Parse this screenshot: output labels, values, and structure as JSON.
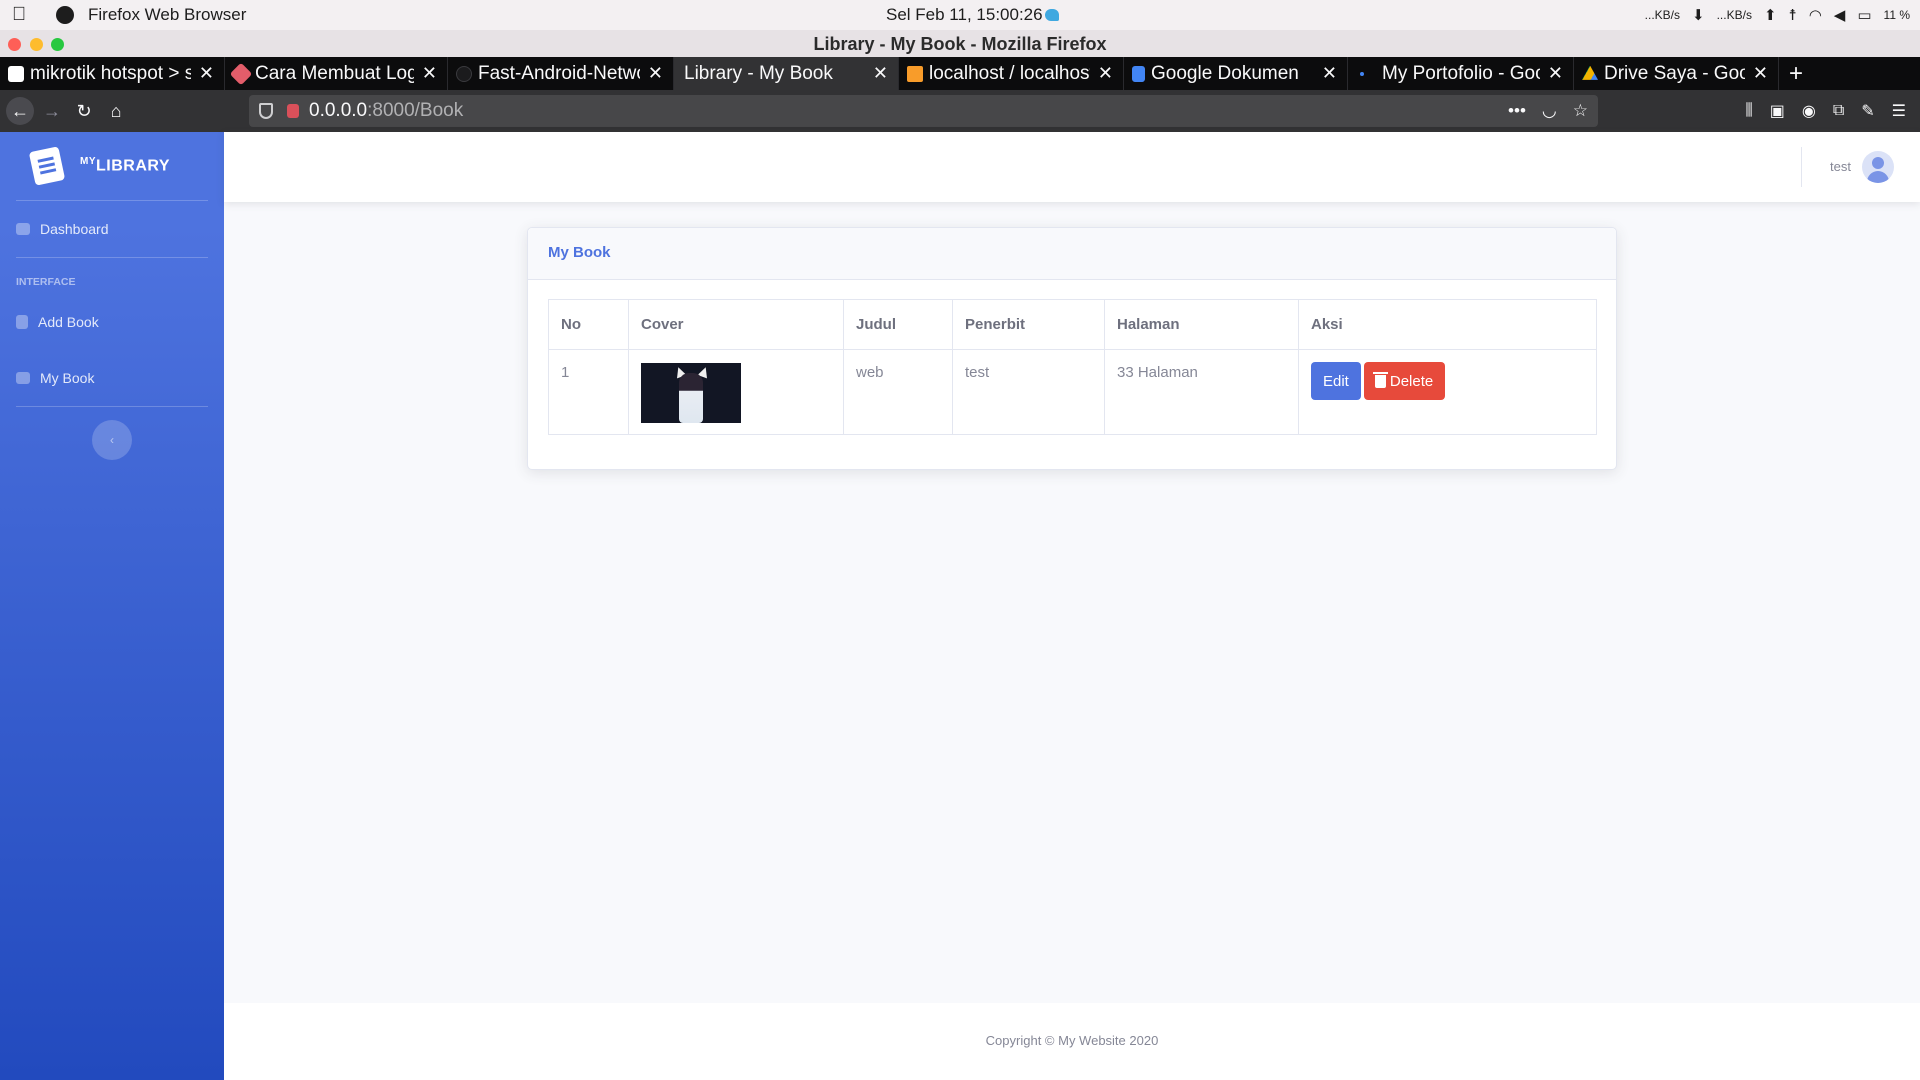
{
  "menubar": {
    "app_name": "Firefox Web Browser",
    "clock": "Sel Feb 11, 15:00:26",
    "net_down": "...KB/s",
    "net_up": "...KB/s",
    "battery": "11 %"
  },
  "window": {
    "title": "Library - My Book - Mozilla Firefox"
  },
  "tabs": [
    {
      "label": "mikrotik hotspot > s",
      "active": false
    },
    {
      "label": "Cara Membuat Logi",
      "active": false
    },
    {
      "label": "Fast-Android-Netwo",
      "active": false
    },
    {
      "label": "Library - My Book",
      "active": true
    },
    {
      "label": "localhost / localhost",
      "active": false
    },
    {
      "label": "Google Dokumen",
      "active": false
    },
    {
      "label": "My Portofolio - Goo",
      "active": false
    },
    {
      "label": "Drive Saya - Google",
      "active": false
    }
  ],
  "address": {
    "host": "0.0.0.0",
    "path": ":8000/Book"
  },
  "sidebar": {
    "brand_sup": "MY",
    "brand": "LIBRARY",
    "dashboard": "Dashboard",
    "heading": "INTERFACE",
    "add_book": "Add Book",
    "my_book": "My Book"
  },
  "topbar": {
    "username": "test"
  },
  "card": {
    "title": "My Book",
    "columns": [
      "No",
      "Cover",
      "Judul",
      "Penerbit",
      "Halaman",
      "Aksi"
    ],
    "rows": [
      {
        "no": "1",
        "judul": "web",
        "penerbit": "test",
        "halaman": "33 Halaman"
      }
    ],
    "edit_label": "Edit",
    "delete_label": "Delete"
  },
  "footer": {
    "text": "Copyright © My Website 2020"
  },
  "colors": {
    "primary": "#4e73df",
    "danger": "#e74a3b"
  }
}
